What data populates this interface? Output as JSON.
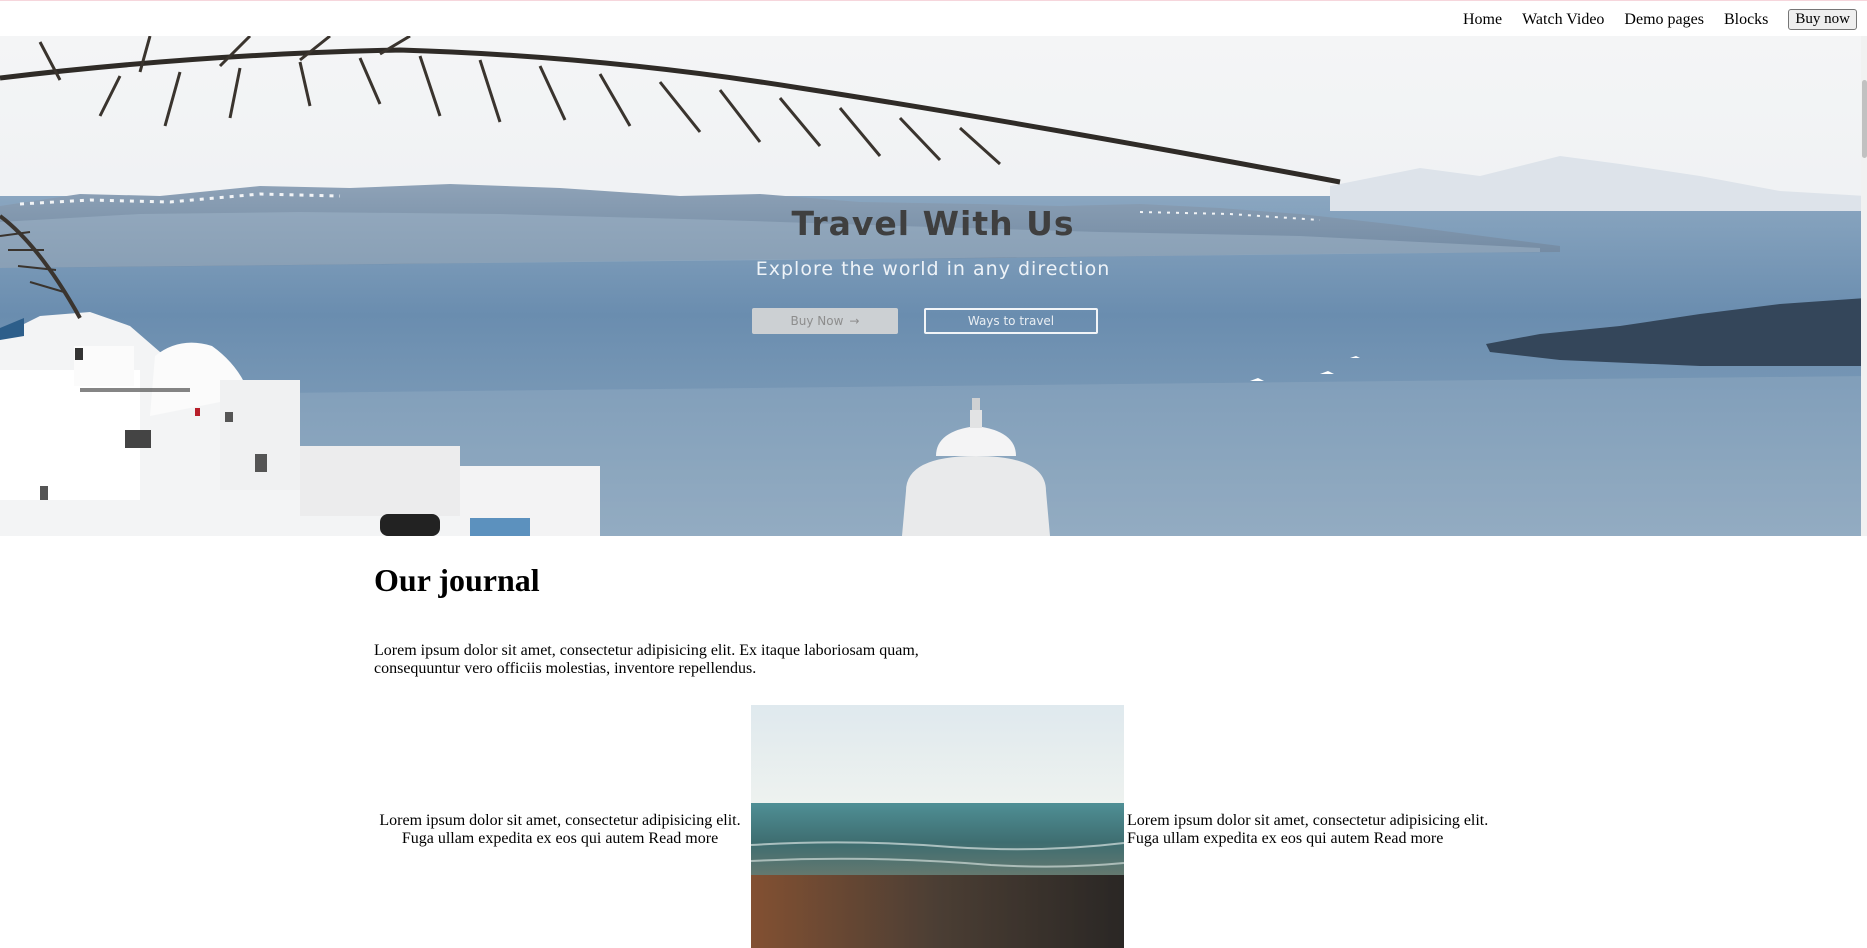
{
  "nav": {
    "items": [
      {
        "label": "Home"
      },
      {
        "label": "Watch Video"
      },
      {
        "label": "Demo pages"
      },
      {
        "label": "Blocks"
      }
    ],
    "buy_label": "Buy now"
  },
  "hero": {
    "title": "Travel With Us",
    "subtitle": "Explore the world in any direction",
    "primary_button": "Buy Now",
    "secondary_button": "Ways to travel"
  },
  "journal": {
    "title": "Our journal",
    "intro": "Lorem ipsum dolor sit amet, consectetur adipisicing elit. Ex itaque laboriosam quam, consequuntur vero officiis molestias, inventore repellendus.",
    "cards": [
      {
        "text": "Lorem ipsum dolor sit amet, consectetur adipisicing elit. Fuga ullam expedita ex eos qui autem",
        "link": "Read more"
      },
      {
        "text": "Lorem ipsum dolor sit amet, consectetur adipisicing elit. Fuga ullam expedita ex eos qui autem",
        "link": "Read more"
      }
    ]
  },
  "colors": {
    "sea": "#5f84a6",
    "sky": "#eef1f4",
    "title_text": "#3f3f3f"
  }
}
